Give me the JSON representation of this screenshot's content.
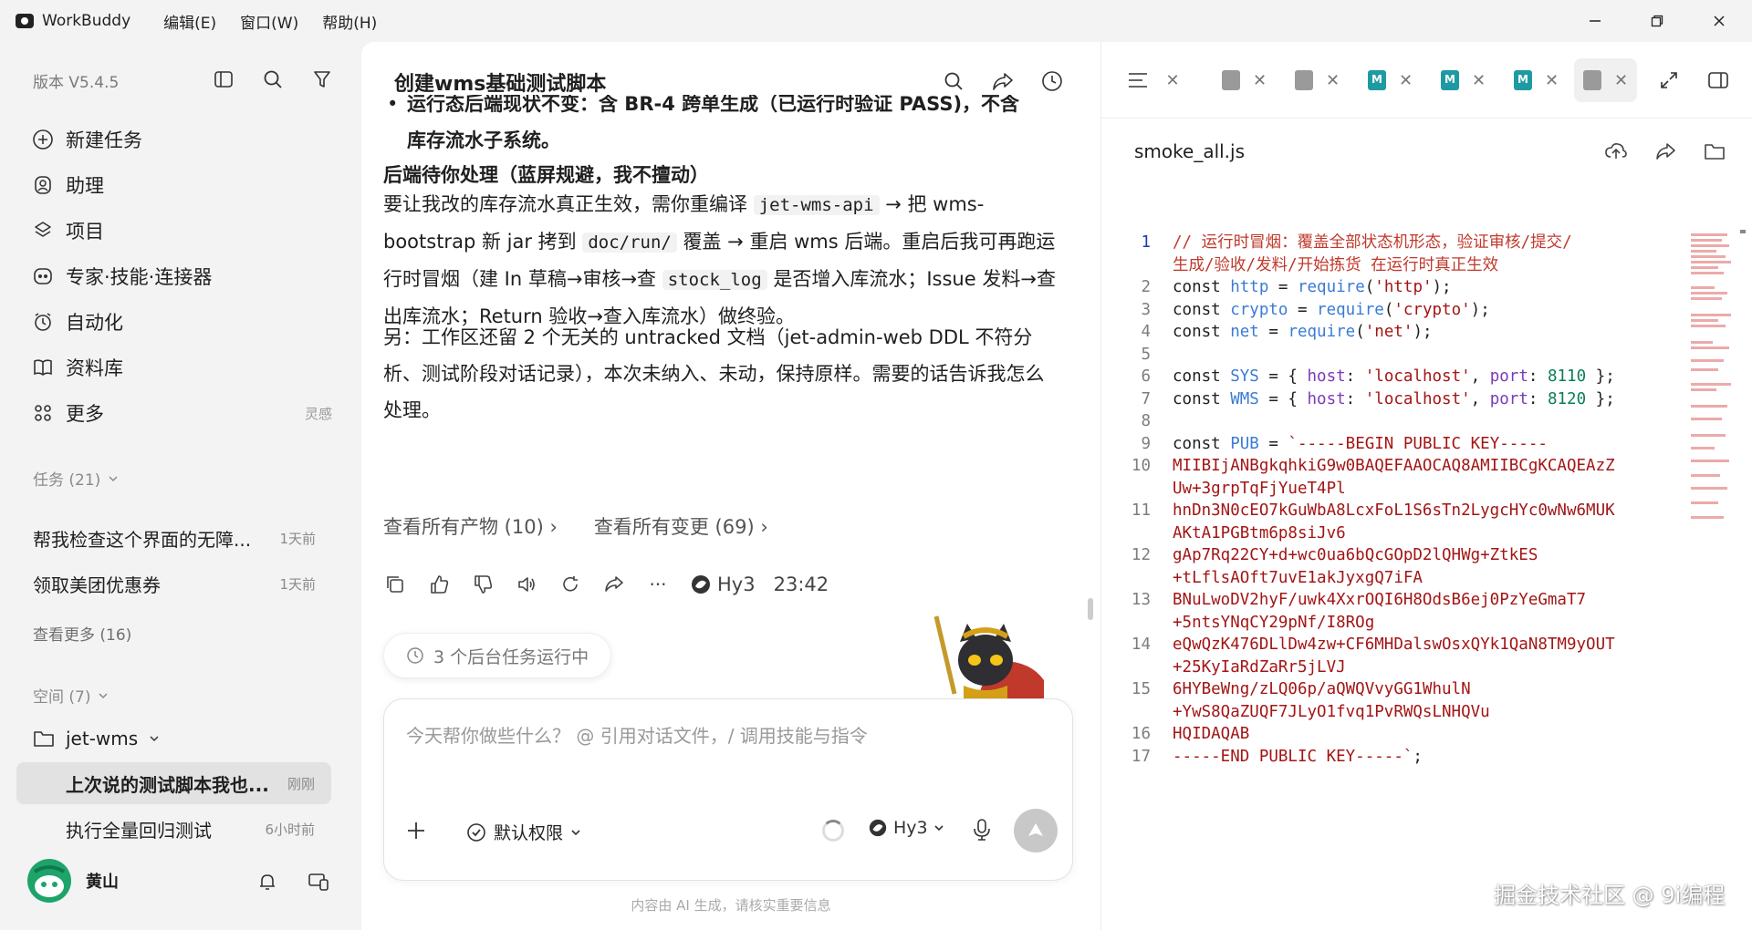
{
  "titlebar": {
    "app_name": "WorkBuddy",
    "menus": [
      "编辑(E)",
      "窗口(W)",
      "帮助(H)"
    ]
  },
  "sidebar": {
    "version": "版本 V5.4.5",
    "nav": [
      {
        "label": "新建任务",
        "icon": "new-task-icon"
      },
      {
        "label": "助理",
        "icon": "assistant-icon"
      },
      {
        "label": "项目",
        "icon": "project-icon"
      },
      {
        "label": "专家·技能·连接器",
        "icon": "expert-icon"
      },
      {
        "label": "自动化",
        "icon": "automation-icon"
      },
      {
        "label": "资料库",
        "icon": "library-icon"
      },
      {
        "label": "更多",
        "icon": "more-icon",
        "hint": "灵感"
      }
    ],
    "tasks_label": "任务 (21)",
    "tasks": [
      {
        "title": "帮我检查这个界面的无障...",
        "time": "1天前"
      },
      {
        "title": "领取美团优惠券",
        "time": "1天前"
      }
    ],
    "see_more": "查看更多 (16)",
    "spaces_label": "空间 (7)",
    "folder": "jet-wms",
    "subtasks": [
      {
        "title": "上次说的测试脚本我也...",
        "time": "刚刚",
        "active": true
      },
      {
        "title": "执行全量回归测试",
        "time": "6小时前",
        "active": false
      }
    ],
    "user_name": "黄山"
  },
  "chat": {
    "title": "创建wms基础测试脚本",
    "bullet_text": "运行态后端现状不变：含 BR-4 跨单生成（已运行时验证 PASS)，不含库存流水子系统。",
    "bullet_line1": "运行态后端现状不变：含 BR-4 跨单生成（已运行时验证 PASS)，不含",
    "bullet_line2": "库存流水子系统。",
    "section_heading": "后端待你处理（蓝屏规避，我不擅动）",
    "para1": {
      "a": "要让我改的库存流水真正生效，需你重编译 ",
      "code1": "jet-wms-api",
      "b": " → 把 wms-bootstrap 新 jar 拷到 ",
      "code2": "doc/run/",
      "c": " 覆盖 → 重启 wms 后端。重启后我可再跑运行时冒烟（建 In 草稿→审核→查 ",
      "code3": "stock_log",
      "d": " 是否增入库流水；Issue 发料→查出库流水；Return 验收→查入库流水）做终验。"
    },
    "para2": "另：工作区还留 2 个无关的 untracked 文档（jet-admin-web DDL 不符分析、测试阶段对话记录），本次未纳入、未动，保持原样。需要的话告诉我怎么处理。",
    "artifacts_link": "查看所有产物 (10)",
    "changes_link": "查看所有变更 (69)",
    "model_name": "Hy3",
    "time": "23:42",
    "bg_tasks": "3 个后台任务运行中",
    "composer_placeholder": "今天帮你做些什么？ @ 引用对话文件，/ 调用技能与指令",
    "permission": "默认权限",
    "composer_model": "Hy3",
    "footnote": "内容由 AI 生成，请核实重要信息"
  },
  "editor": {
    "filename": "smoke_all.js",
    "watermark": "掘金技术社区 @ 9i编程",
    "code": [
      {
        "n": "1",
        "cur": true,
        "html": "<span class='cm'>// 运行时冒烟：覆盖全部状态机形态，验证审核/提交/</span>"
      },
      {
        "n": "",
        "html": "<span class='cm'>生成/验收/发料/开始拣货 在运行时真正生效</span>"
      },
      {
        "n": "2",
        "html": "const <span class='var'>http</span> = <span class='var'>require</span>(<span class='str'>'http'</span>);"
      },
      {
        "n": "3",
        "html": "const <span class='var'>crypto</span> = <span class='var'>require</span>(<span class='str'>'crypto'</span>);"
      },
      {
        "n": "4",
        "html": "const <span class='var'>net</span> = <span class='var'>require</span>(<span class='str'>'net'</span>);"
      },
      {
        "n": "5",
        "html": ""
      },
      {
        "n": "6",
        "html": "const <span class='var'>SYS</span> = { <span class='prop'>host</span>: <span class='str'>'localhost'</span>, <span class='prop'>port</span>: <span class='num'>8110</span> };"
      },
      {
        "n": "7",
        "html": "const <span class='var'>WMS</span> = { <span class='prop'>host</span>: <span class='str'>'localhost'</span>, <span class='prop'>port</span>: <span class='num'>8120</span> };"
      },
      {
        "n": "8",
        "html": ""
      },
      {
        "n": "9",
        "html": "const <span class='var'>PUB</span> = <span class='str'>`-----BEGIN PUBLIC KEY-----</span>"
      },
      {
        "n": "10",
        "html": "<span class='str'>MIIBIjANBgkqhkiG9w0BAQEFAAOCAQ8AMIIBCgKCAQEAzZ</span>"
      },
      {
        "n": "",
        "html": "<span class='str'>Uw+3grpTqFjYueT4Pl</span>"
      },
      {
        "n": "11",
        "html": "<span class='str'>hnDn3N0cEO7kGuWbA8LcxFoL1S6sTn2LygcHYc0wNw6MUK</span>"
      },
      {
        "n": "",
        "html": "<span class='str'>AKtA1PGBtm6p8siJv6</span>"
      },
      {
        "n": "12",
        "html": "<span class='str'>gAp7Rq22CY+d+wc0ua6bQcGOpD2lQHWg+ZtkES</span>"
      },
      {
        "n": "",
        "html": "<span class='str'>+tLflsAOft7uvE1akJyxgQ7iFA</span>"
      },
      {
        "n": "13",
        "html": "<span class='str'>BNuLwoDV2hyF/uwk4XxrOQI6H8OdsB6ej0PzYeGmaT7</span>"
      },
      {
        "n": "",
        "html": "<span class='str'>+5ntsYNqCY29pNf/I8ROg</span>"
      },
      {
        "n": "14",
        "html": "<span class='str'>eQwQzK476DLlDw4zw+CF6MHDalswOsxQYk1QaN8TM9yOUT</span>"
      },
      {
        "n": "",
        "html": "<span class='str'>+25KyIaRdZaRr5jLVJ</span>"
      },
      {
        "n": "15",
        "html": "<span class='str'>6HYBeWng/zLQ06p/aQWQVvyGG1WhulN</span>"
      },
      {
        "n": "",
        "html": "<span class='str'>+YwS8QaZUQF7JLyO1fvq1PvRWQsLNHQVu</span>"
      },
      {
        "n": "16",
        "html": "<span class='str'>HQIDAQAB</span>"
      },
      {
        "n": "17",
        "html": "<span class='str'>-----END PUBLIC KEY-----`</span>;"
      }
    ]
  },
  "colors": {
    "accent": "#1f3aa8",
    "md_icon": "#1e9aa3",
    "avatar": "#1ea36b"
  }
}
